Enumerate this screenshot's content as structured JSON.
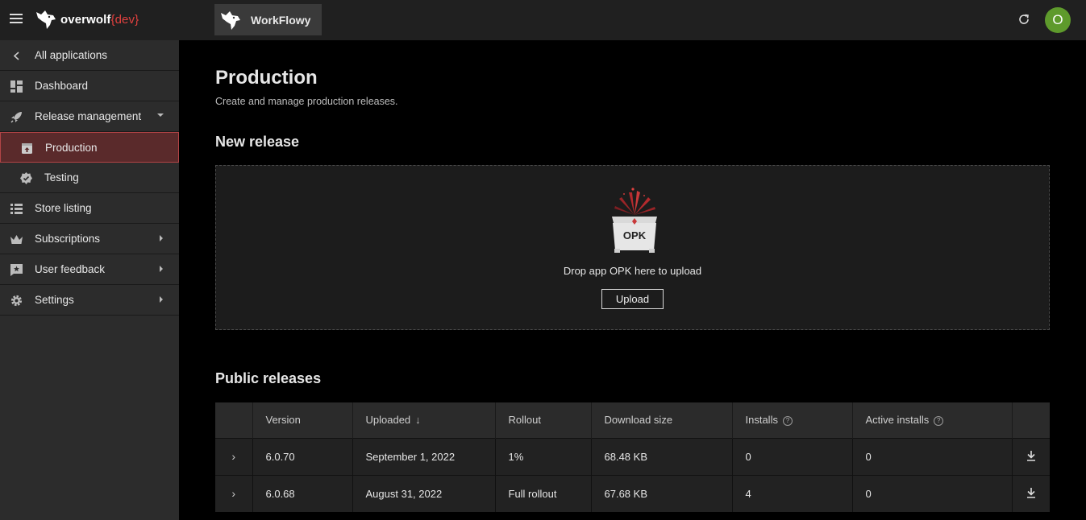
{
  "header": {
    "brand_name": "overwolf",
    "brand_suffix": "{dev}",
    "app_name": "WorkFlowy",
    "avatar_initial": "O",
    "brand_accent": "#e0413f",
    "avatar_color": "#5e9a2c"
  },
  "sidebar": {
    "items": [
      {
        "label": "All applications",
        "icon": "chevron-left-icon"
      },
      {
        "label": "Dashboard",
        "icon": "dashboard-icon"
      },
      {
        "label": "Release management",
        "icon": "rocket-icon",
        "expanded": true
      },
      {
        "label": "Production",
        "icon": "upload-box-icon",
        "active": true
      },
      {
        "label": "Testing",
        "icon": "badge-check-icon"
      },
      {
        "label": "Store listing",
        "icon": "list-icon"
      },
      {
        "label": "Subscriptions",
        "icon": "crown-icon"
      },
      {
        "label": "User feedback",
        "icon": "feedback-icon"
      },
      {
        "label": "Settings",
        "icon": "gear-icon"
      }
    ]
  },
  "main": {
    "title": "Production",
    "subtitle": "Create and manage production releases.",
    "new_release_title": "New release",
    "drop_text": "Drop app OPK here to upload",
    "upload_label": "Upload",
    "opk_label": "OPK",
    "public_releases_title": "Public releases"
  },
  "table": {
    "headers": {
      "version": "Version",
      "uploaded": "Uploaded",
      "rollout": "Rollout",
      "download_size": "Download size",
      "installs": "Installs",
      "active_installs": "Active installs"
    },
    "rows": [
      {
        "version": "6.0.70",
        "uploaded": "September 1, 2022",
        "rollout": "1%",
        "download_size": "68.48 KB",
        "installs": "0",
        "active_installs": "0"
      },
      {
        "version": "6.0.68",
        "uploaded": "August 31, 2022",
        "rollout": "Full rollout",
        "download_size": "67.68 KB",
        "installs": "4",
        "active_installs": "0"
      }
    ]
  }
}
